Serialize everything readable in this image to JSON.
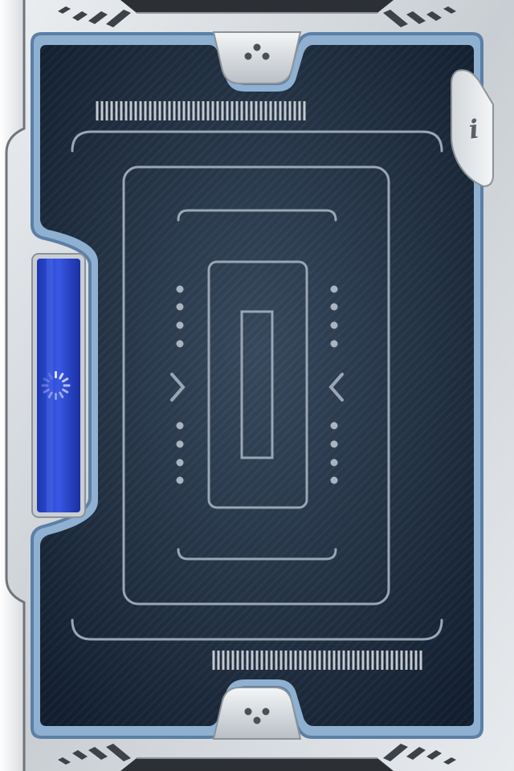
{
  "screen": {
    "name": "scanner-loading-screen",
    "info_button": {
      "glyph": "i",
      "icon": "info-icon"
    },
    "side_loader": {
      "icon": "loading-spinner-icon",
      "state": "loading"
    },
    "scanner_target": {
      "left_chevron_icon": "chevron-left-icon",
      "right_chevron_icon": "chevron-left-icon"
    }
  },
  "colors": {
    "metal_light": "#e6e9ec",
    "metal_dark": "#9aa1a8",
    "panel_blue": "#1a2738",
    "panel_edge": "#5b7fa6",
    "line_grey": "#9aa6b4",
    "loader_blue": "#2f4fd6"
  }
}
